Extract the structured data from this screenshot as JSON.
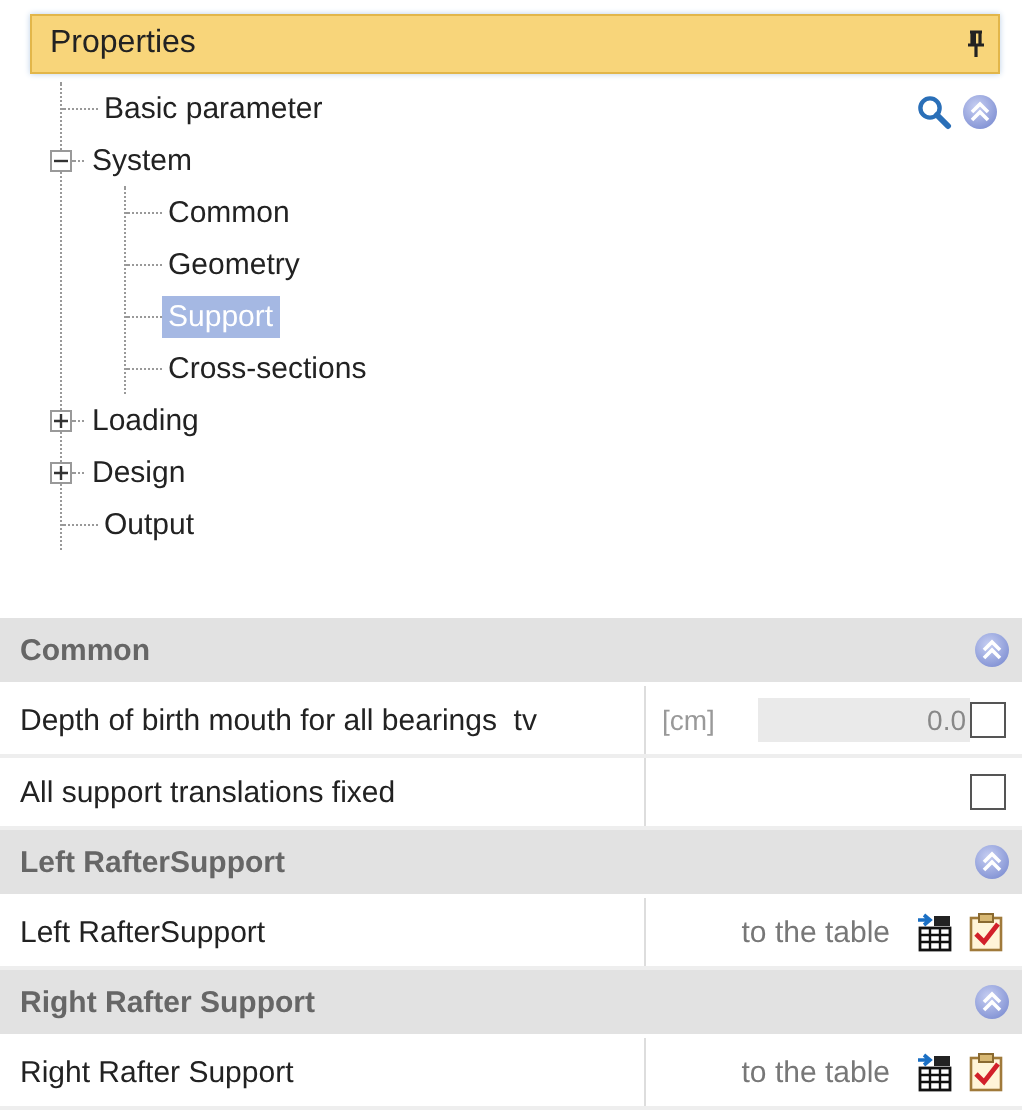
{
  "panel": {
    "title": "Properties"
  },
  "tree": [
    {
      "kind": "leaf",
      "label": "Basic parameter",
      "selected": false
    },
    {
      "kind": "folder",
      "label": "System",
      "selected": false,
      "expanded": true,
      "children": [
        {
          "kind": "leaf",
          "label": "Common",
          "selected": false
        },
        {
          "kind": "leaf",
          "label": "Geometry",
          "selected": false
        },
        {
          "kind": "leaf",
          "label": "Support",
          "selected": true
        },
        {
          "kind": "leaf",
          "label": "Cross-sections",
          "selected": false
        }
      ]
    },
    {
      "kind": "folder",
      "label": "Loading",
      "selected": false,
      "expanded": false
    },
    {
      "kind": "folder",
      "label": "Design",
      "selected": false,
      "expanded": false
    },
    {
      "kind": "leaf",
      "label": "Output",
      "selected": false
    }
  ],
  "sections": [
    {
      "title": "Common",
      "expanded": true,
      "rows": [
        {
          "kind": "unit-checkbox",
          "label": "Depth of birth mouth for all bearings  tv",
          "unit": "[cm]",
          "value": "0.0",
          "checked": false
        },
        {
          "kind": "checkbox",
          "label": "All support translations fixed",
          "checked": false
        }
      ]
    },
    {
      "title": "Left RafterSupport",
      "expanded": true,
      "rows": [
        {
          "kind": "table-link",
          "label": "Left RafterSupport",
          "link": "to the table"
        }
      ]
    },
    {
      "title": "Right Rafter Support",
      "expanded": true,
      "rows": [
        {
          "kind": "table-link",
          "label": "Right Rafter Support",
          "link": "to the table"
        }
      ]
    }
  ]
}
